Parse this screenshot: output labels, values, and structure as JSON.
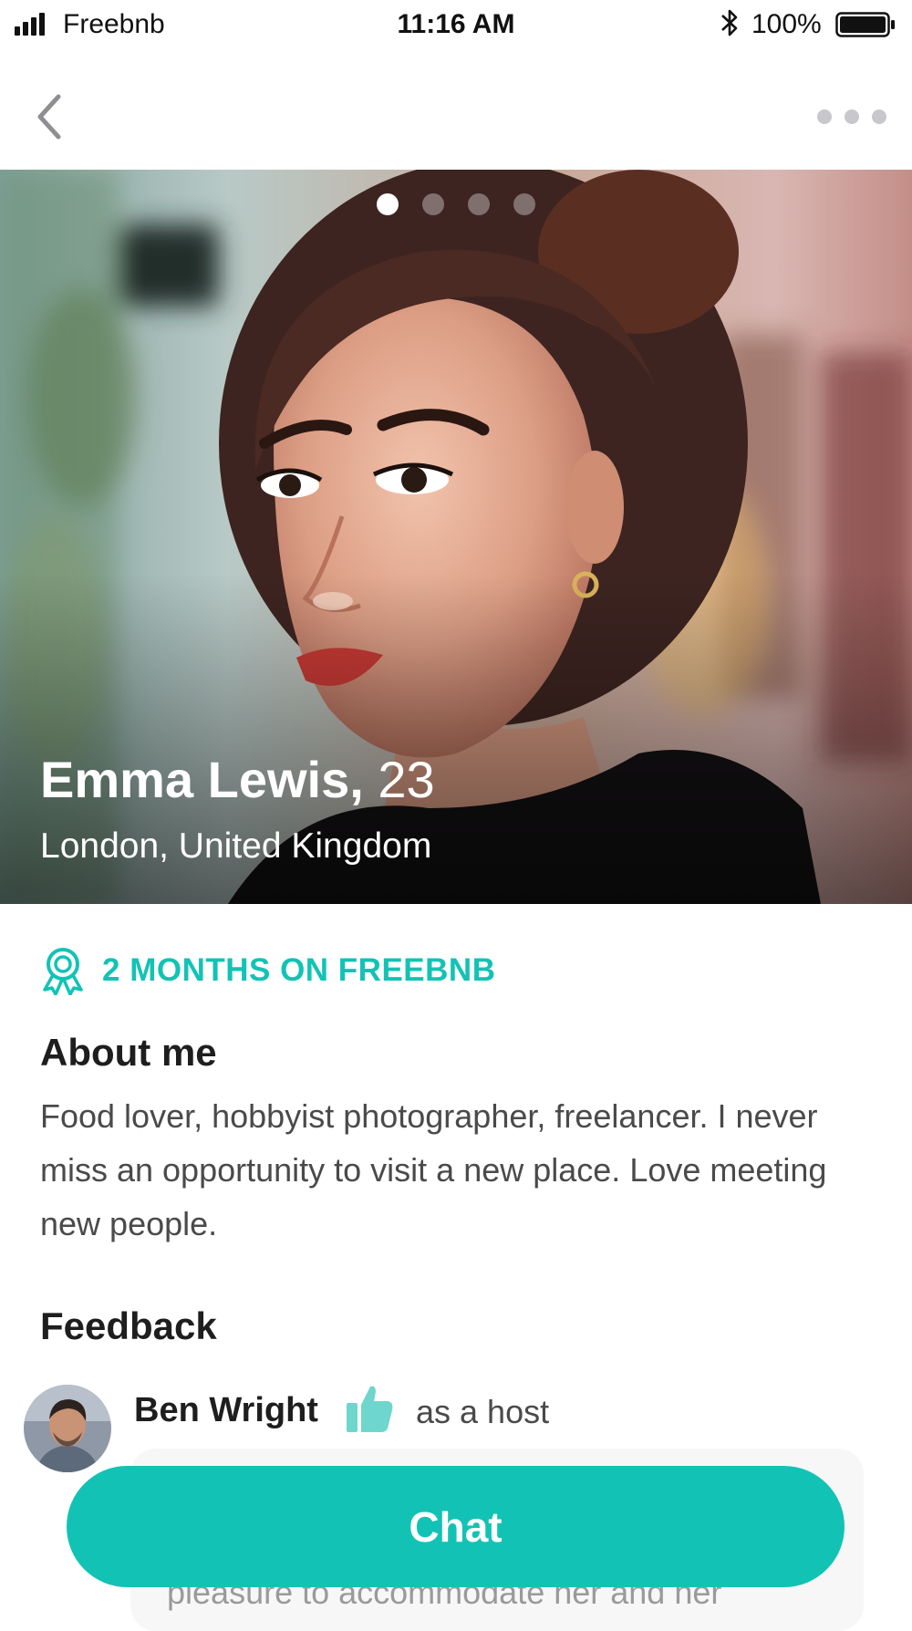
{
  "status_bar": {
    "carrier": "Freebnb",
    "time": "11:16 AM",
    "battery": "100%"
  },
  "nav": {
    "back_icon": "chevron-left-icon",
    "more_icon": "more-horizontal-icon"
  },
  "profile": {
    "name": "Emma Lewis,",
    "age": "23",
    "location": "London, United Kingdom",
    "photo_count": 4,
    "active_photo": 1
  },
  "membership": {
    "icon": "award-icon",
    "label": "2 MONTHS ON FREEBNB"
  },
  "about": {
    "heading": "About me",
    "text": "Food lover, hobbyist photographer, freelancer. I never miss an opportunity to visit a new place. Love meeting new people."
  },
  "feedback": {
    "heading": "Feedback",
    "items": [
      {
        "reviewer": "Ben Wright",
        "icon": "thumbs-up-icon",
        "role": "as a host",
        "text_fragment": "pleasure to accommodate her and her"
      }
    ]
  },
  "actions": {
    "chat_label": "Chat"
  },
  "colors": {
    "accent": "#12c3b5",
    "thumb": "#6fd6cd",
    "text_primary": "#1e1e1e",
    "text_secondary": "#4a4a4a"
  }
}
